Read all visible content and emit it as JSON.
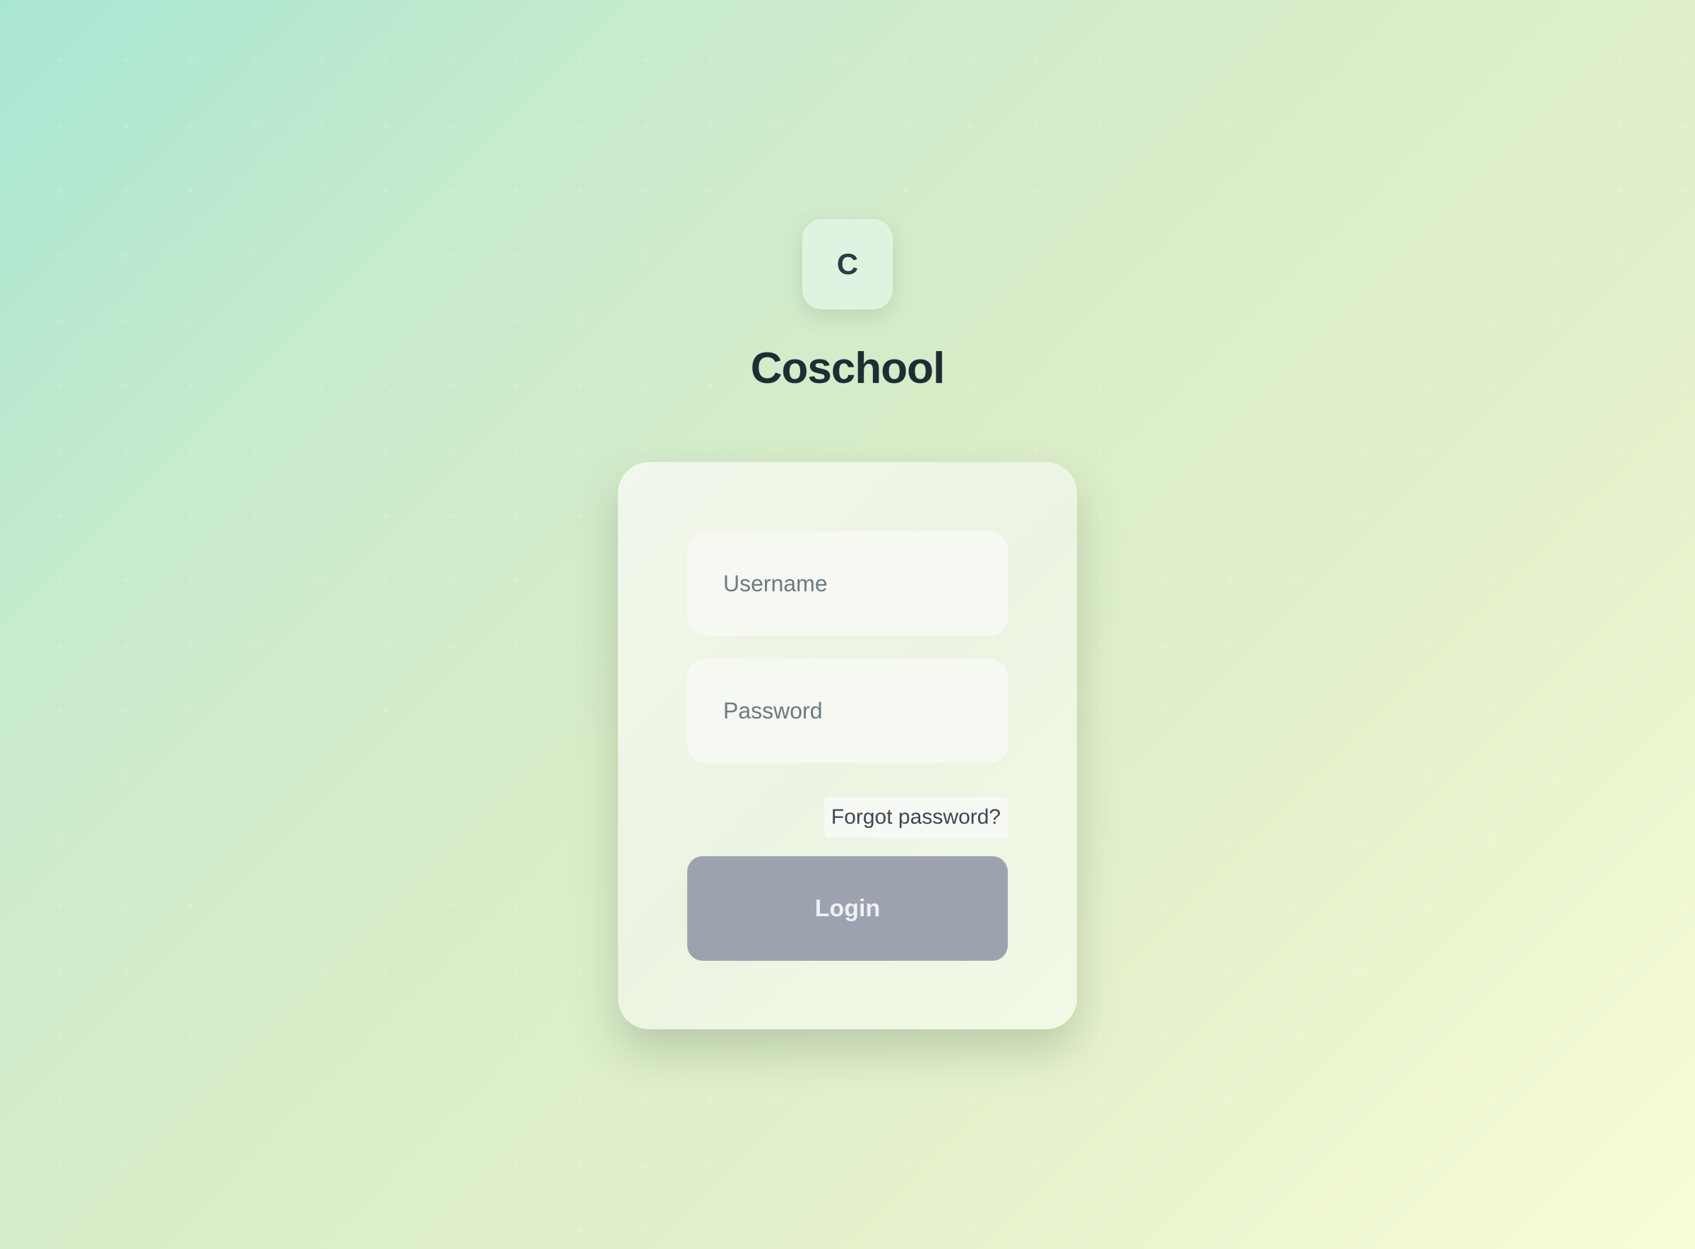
{
  "app": {
    "logo_letter": "C",
    "title": "Coschool"
  },
  "login_form": {
    "username_placeholder": "Username",
    "username_value": "",
    "password_placeholder": "Password",
    "password_value": "",
    "forgot_password_label": "Forgot password?",
    "login_button_label": "Login"
  },
  "colors": {
    "background_start": "#a8e6d3",
    "background_end": "#f6fdd8",
    "card_background": "#eef5e6",
    "login_button_disabled": "#9ca3ae",
    "title_text": "#1f2d36"
  }
}
